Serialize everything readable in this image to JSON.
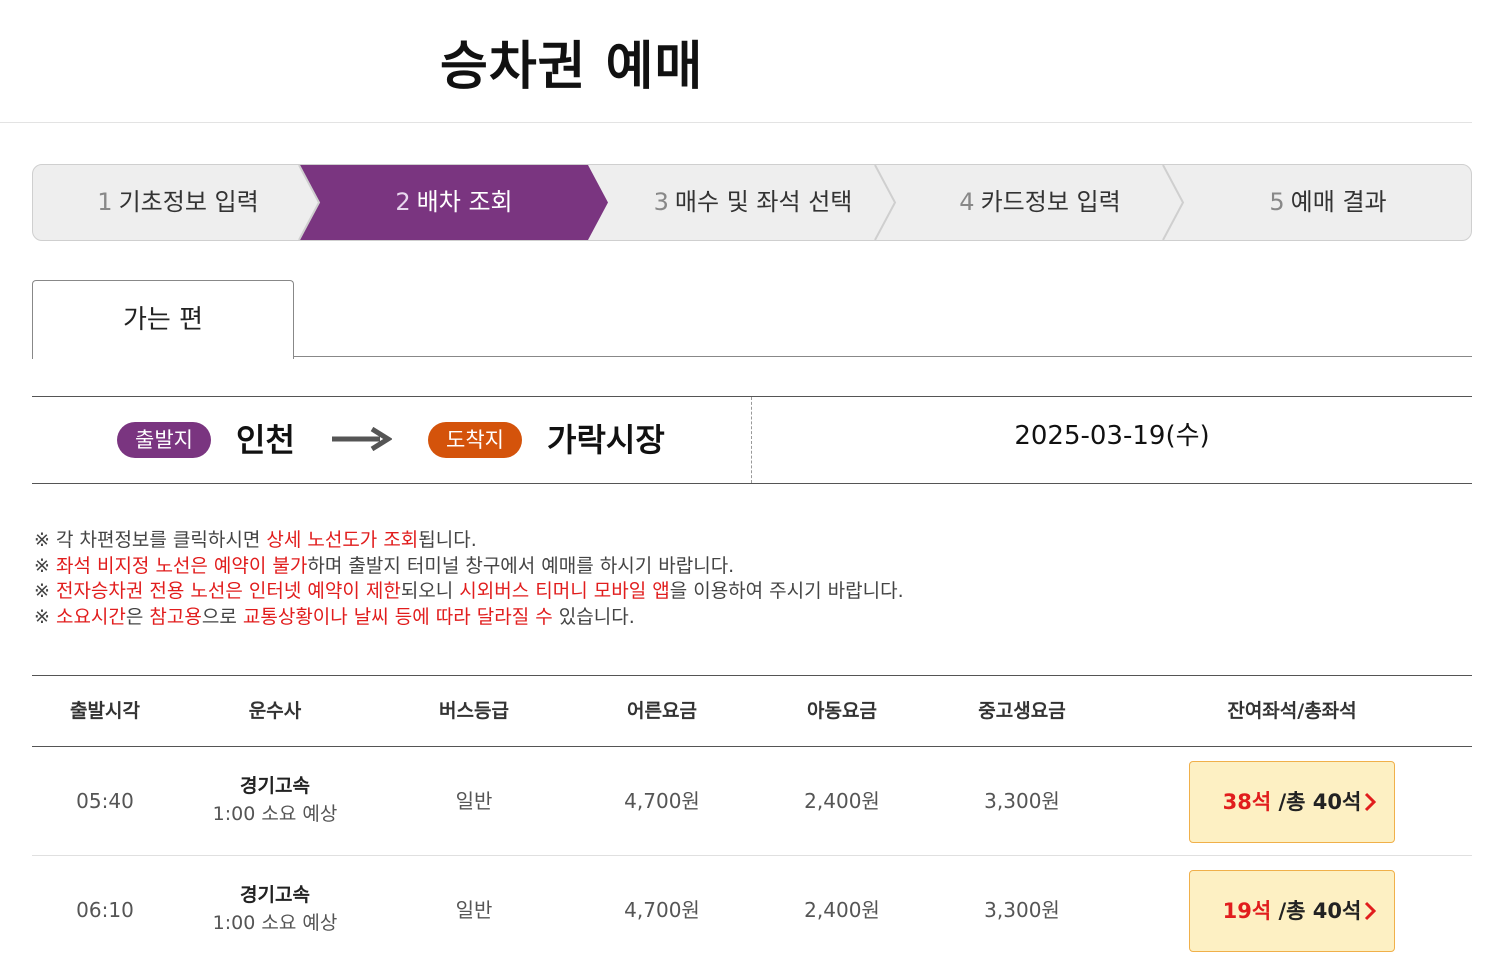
{
  "header": {
    "title": "승차권 예매"
  },
  "steps": [
    {
      "num": "1",
      "label": "기초정보 입력"
    },
    {
      "num": "2",
      "label": "배차 조회"
    },
    {
      "num": "3",
      "label": "매수 및 좌석 선택"
    },
    {
      "num": "4",
      "label": "카드정보 입력"
    },
    {
      "num": "5",
      "label": "예매 결과"
    }
  ],
  "tabs": {
    "outbound": "가는 편"
  },
  "route": {
    "departure_badge": "출발지",
    "departure": "인천",
    "arrival_badge": "도착지",
    "arrival": "가락시장",
    "date": "2025-03-19(수)"
  },
  "notices": {
    "n1": {
      "a": "※ 각 차편정보를 클릭하시면 ",
      "b": "상세 노선도가 조회",
      "c": "됩니다."
    },
    "n2": {
      "a": "※ ",
      "b": "좌석 비지정 노선은 예약이 불가",
      "c": "하며 출발지 터미널 창구에서 예매를 하시기 바랍니다."
    },
    "n3": {
      "a": "※ ",
      "b": "전자승차권 전용 노선은 인터넷 예약이 제한",
      "c": "되오니 ",
      "d": "시외버스 티머니 모바일 앱",
      "e": "을 이용하여 주시기 바랍니다."
    },
    "n4": {
      "a": "※ ",
      "b": "소요시간",
      "c": "은 ",
      "d": "참고용",
      "e": "으로 ",
      "f": "교통상황이나 날씨 등에 따라 달라질 수",
      "g": " 있습니다."
    }
  },
  "table": {
    "headers": {
      "departure_time": "출발시각",
      "company": "운수사",
      "bus_class": "버스등급",
      "adult_fare": "어른요금",
      "child_fare": "아동요금",
      "student_fare": "중고생요금",
      "seats": "잔여좌석/총좌석"
    },
    "rows": [
      {
        "time": "05:40",
        "company": "경기고속",
        "duration": "1:00 소요 예상",
        "bus_class": "일반",
        "adult_fare": "4,700원",
        "child_fare": "2,400원",
        "student_fare": "3,300원",
        "remaining": "38석",
        "total": " /총 40석"
      },
      {
        "time": "06:10",
        "company": "경기고속",
        "duration": "1:00 소요 예상",
        "bus_class": "일반",
        "adult_fare": "4,700원",
        "child_fare": "2,400원",
        "student_fare": "3,300원",
        "remaining": "19석",
        "total": " /총 40석"
      }
    ]
  },
  "colors": {
    "active_step": "#7a3580",
    "departure_badge": "#7a3580",
    "arrival_badge": "#d4530b",
    "highlight": "#e11d1d",
    "seat_button_bg": "#fdf0c3"
  },
  "icons": [
    "arrow-right-icon",
    "chevron-right-icon"
  ]
}
